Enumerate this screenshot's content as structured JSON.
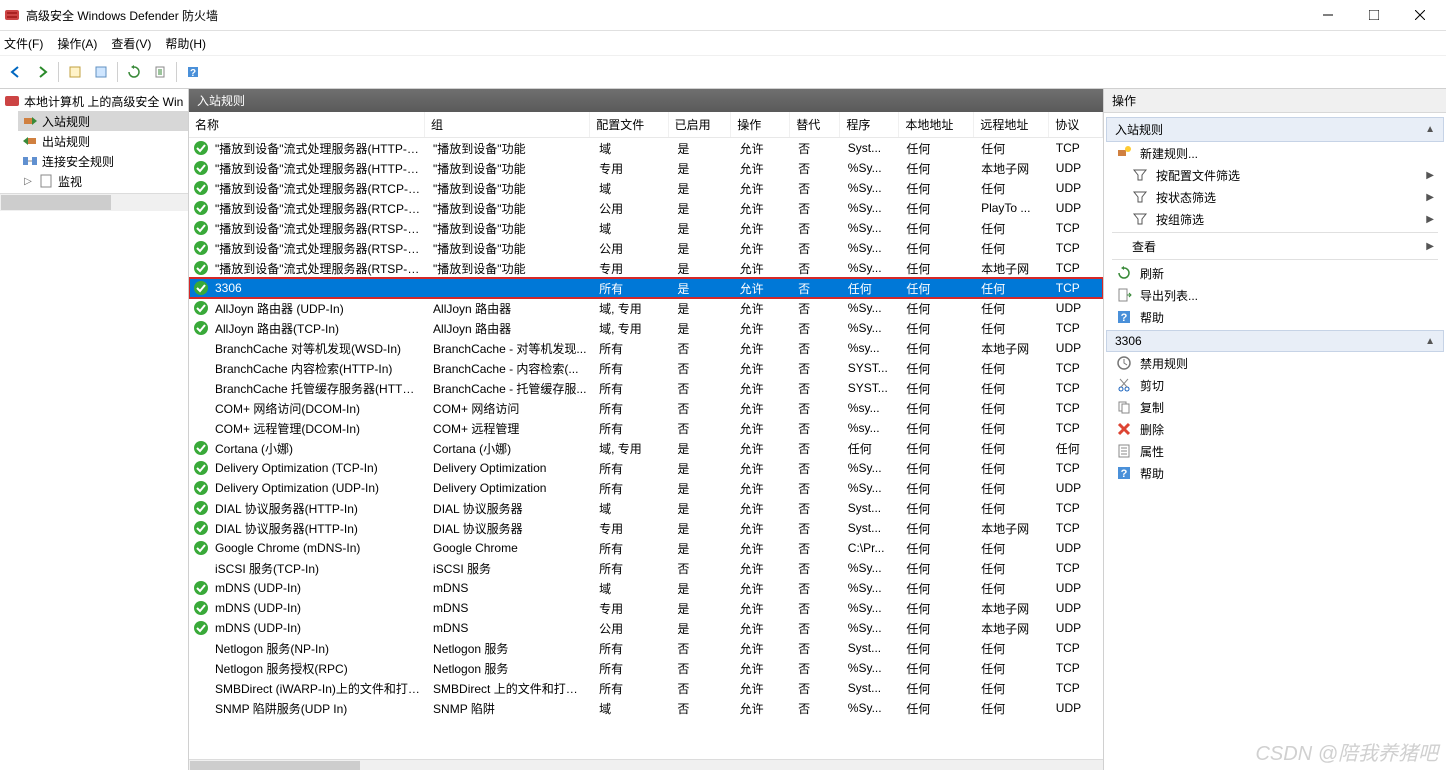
{
  "title": "高级安全 Windows Defender 防火墙",
  "menu": {
    "file": "文件(F)",
    "action": "操作(A)",
    "view": "查看(V)",
    "help": "帮助(H)"
  },
  "tree": {
    "root": "本地计算机 上的高级安全 Win",
    "inbound": "入站规则",
    "outbound": "出站规则",
    "connsec": "连接安全规则",
    "monitor": "监视"
  },
  "mid_header": "入站规则",
  "columns": {
    "name": "名称",
    "group": "组",
    "profile": "配置文件",
    "enabled": "已启用",
    "action": "操作",
    "override": "替代",
    "program": "程序",
    "localaddr": "本地地址",
    "remoteaddr": "远程地址",
    "protocol": "协议"
  },
  "rows": [
    {
      "en": true,
      "name": "\"播放到设备\"流式处理服务器(HTTP-Stre...",
      "group": "\"播放到设备\"功能",
      "profile": "域",
      "enabled": "是",
      "action": "允许",
      "override": "否",
      "program": "Syst...",
      "local": "任何",
      "remote": "任何",
      "proto": "TCP"
    },
    {
      "en": true,
      "name": "\"播放到设备\"流式处理服务器(HTTP-Stre...",
      "group": "\"播放到设备\"功能",
      "profile": "专用",
      "enabled": "是",
      "action": "允许",
      "override": "否",
      "program": "%Sy...",
      "local": "任何",
      "remote": "本地子网",
      "proto": "UDP"
    },
    {
      "en": true,
      "name": "\"播放到设备\"流式处理服务器(RTCP-Stre...",
      "group": "\"播放到设备\"功能",
      "profile": "域",
      "enabled": "是",
      "action": "允许",
      "override": "否",
      "program": "%Sy...",
      "local": "任何",
      "remote": "任何",
      "proto": "UDP"
    },
    {
      "en": true,
      "name": "\"播放到设备\"流式处理服务器(RTCP-Stre...",
      "group": "\"播放到设备\"功能",
      "profile": "公用",
      "enabled": "是",
      "action": "允许",
      "override": "否",
      "program": "%Sy...",
      "local": "任何",
      "remote": "PlayTo ...",
      "proto": "UDP"
    },
    {
      "en": true,
      "name": "\"播放到设备\"流式处理服务器(RTSP-Stre...",
      "group": "\"播放到设备\"功能",
      "profile": "域",
      "enabled": "是",
      "action": "允许",
      "override": "否",
      "program": "%Sy...",
      "local": "任何",
      "remote": "任何",
      "proto": "TCP"
    },
    {
      "en": true,
      "name": "\"播放到设备\"流式处理服务器(RTSP-Stre...",
      "group": "\"播放到设备\"功能",
      "profile": "公用",
      "enabled": "是",
      "action": "允许",
      "override": "否",
      "program": "%Sy...",
      "local": "任何",
      "remote": "任何",
      "proto": "TCP"
    },
    {
      "en": true,
      "name": "\"播放到设备\"流式处理服务器(RTSP-Stre...",
      "group": "\"播放到设备\"功能",
      "profile": "专用",
      "enabled": "是",
      "action": "允许",
      "override": "否",
      "program": "%Sy...",
      "local": "任何",
      "remote": "本地子网",
      "proto": "TCP"
    },
    {
      "sel": true,
      "en": true,
      "name": "3306",
      "group": "",
      "profile": "所有",
      "enabled": "是",
      "action": "允许",
      "override": "否",
      "program": "任何",
      "local": "任何",
      "remote": "任何",
      "proto": "TCP"
    },
    {
      "en": true,
      "name": "AllJoyn 路由器 (UDP-In)",
      "group": "AllJoyn 路由器",
      "profile": "域, 专用",
      "enabled": "是",
      "action": "允许",
      "override": "否",
      "program": "%Sy...",
      "local": "任何",
      "remote": "任何",
      "proto": "UDP"
    },
    {
      "en": true,
      "name": "AllJoyn 路由器(TCP-In)",
      "group": "AllJoyn 路由器",
      "profile": "域, 专用",
      "enabled": "是",
      "action": "允许",
      "override": "否",
      "program": "%Sy...",
      "local": "任何",
      "remote": "任何",
      "proto": "TCP"
    },
    {
      "en": false,
      "name": "BranchCache 对等机发现(WSD-In)",
      "group": "BranchCache - 对等机发现...",
      "profile": "所有",
      "enabled": "否",
      "action": "允许",
      "override": "否",
      "program": "%sy...",
      "local": "任何",
      "remote": "本地子网",
      "proto": "UDP"
    },
    {
      "en": false,
      "name": "BranchCache 内容检索(HTTP-In)",
      "group": "BranchCache - 内容检索(...",
      "profile": "所有",
      "enabled": "否",
      "action": "允许",
      "override": "否",
      "program": "SYST...",
      "local": "任何",
      "remote": "任何",
      "proto": "TCP"
    },
    {
      "en": false,
      "name": "BranchCache 托管缓存服务器(HTTP-In)",
      "group": "BranchCache - 托管缓存服...",
      "profile": "所有",
      "enabled": "否",
      "action": "允许",
      "override": "否",
      "program": "SYST...",
      "local": "任何",
      "remote": "任何",
      "proto": "TCP"
    },
    {
      "en": false,
      "name": "COM+ 网络访问(DCOM-In)",
      "group": "COM+ 网络访问",
      "profile": "所有",
      "enabled": "否",
      "action": "允许",
      "override": "否",
      "program": "%sy...",
      "local": "任何",
      "remote": "任何",
      "proto": "TCP"
    },
    {
      "en": false,
      "name": "COM+ 远程管理(DCOM-In)",
      "group": "COM+ 远程管理",
      "profile": "所有",
      "enabled": "否",
      "action": "允许",
      "override": "否",
      "program": "%sy...",
      "local": "任何",
      "remote": "任何",
      "proto": "TCP"
    },
    {
      "en": true,
      "name": "Cortana (小娜)",
      "group": "Cortana (小娜)",
      "profile": "域, 专用",
      "enabled": "是",
      "action": "允许",
      "override": "否",
      "program": "任何",
      "local": "任何",
      "remote": "任何",
      "proto": "任何"
    },
    {
      "en": true,
      "name": "Delivery Optimization (TCP-In)",
      "group": "Delivery Optimization",
      "profile": "所有",
      "enabled": "是",
      "action": "允许",
      "override": "否",
      "program": "%Sy...",
      "local": "任何",
      "remote": "任何",
      "proto": "TCP"
    },
    {
      "en": true,
      "name": "Delivery Optimization (UDP-In)",
      "group": "Delivery Optimization",
      "profile": "所有",
      "enabled": "是",
      "action": "允许",
      "override": "否",
      "program": "%Sy...",
      "local": "任何",
      "remote": "任何",
      "proto": "UDP"
    },
    {
      "en": true,
      "name": "DIAL 协议服务器(HTTP-In)",
      "group": "DIAL 协议服务器",
      "profile": "域",
      "enabled": "是",
      "action": "允许",
      "override": "否",
      "program": "Syst...",
      "local": "任何",
      "remote": "任何",
      "proto": "TCP"
    },
    {
      "en": true,
      "name": "DIAL 协议服务器(HTTP-In)",
      "group": "DIAL 协议服务器",
      "profile": "专用",
      "enabled": "是",
      "action": "允许",
      "override": "否",
      "program": "Syst...",
      "local": "任何",
      "remote": "本地子网",
      "proto": "TCP"
    },
    {
      "en": true,
      "name": "Google Chrome (mDNS-In)",
      "group": "Google Chrome",
      "profile": "所有",
      "enabled": "是",
      "action": "允许",
      "override": "否",
      "program": "C:\\Pr...",
      "local": "任何",
      "remote": "任何",
      "proto": "UDP"
    },
    {
      "en": false,
      "name": "iSCSI 服务(TCP-In)",
      "group": "iSCSI 服务",
      "profile": "所有",
      "enabled": "否",
      "action": "允许",
      "override": "否",
      "program": "%Sy...",
      "local": "任何",
      "remote": "任何",
      "proto": "TCP"
    },
    {
      "en": true,
      "name": "mDNS (UDP-In)",
      "group": "mDNS",
      "profile": "域",
      "enabled": "是",
      "action": "允许",
      "override": "否",
      "program": "%Sy...",
      "local": "任何",
      "remote": "任何",
      "proto": "UDP"
    },
    {
      "en": true,
      "name": "mDNS (UDP-In)",
      "group": "mDNS",
      "profile": "专用",
      "enabled": "是",
      "action": "允许",
      "override": "否",
      "program": "%Sy...",
      "local": "任何",
      "remote": "本地子网",
      "proto": "UDP"
    },
    {
      "en": true,
      "name": "mDNS (UDP-In)",
      "group": "mDNS",
      "profile": "公用",
      "enabled": "是",
      "action": "允许",
      "override": "否",
      "program": "%Sy...",
      "local": "任何",
      "remote": "本地子网",
      "proto": "UDP"
    },
    {
      "en": false,
      "name": "Netlogon 服务(NP-In)",
      "group": "Netlogon 服务",
      "profile": "所有",
      "enabled": "否",
      "action": "允许",
      "override": "否",
      "program": "Syst...",
      "local": "任何",
      "remote": "任何",
      "proto": "TCP"
    },
    {
      "en": false,
      "name": "Netlogon 服务授权(RPC)",
      "group": "Netlogon 服务",
      "profile": "所有",
      "enabled": "否",
      "action": "允许",
      "override": "否",
      "program": "%Sy...",
      "local": "任何",
      "remote": "任何",
      "proto": "TCP"
    },
    {
      "en": false,
      "name": "SMBDirect (iWARP-In)上的文件和打印...",
      "group": "SMBDirect 上的文件和打印...",
      "profile": "所有",
      "enabled": "否",
      "action": "允许",
      "override": "否",
      "program": "Syst...",
      "local": "任何",
      "remote": "任何",
      "proto": "TCP"
    },
    {
      "en": false,
      "name": "SNMP 陷阱服务(UDP In)",
      "group": "SNMP 陷阱",
      "profile": "域",
      "enabled": "否",
      "action": "允许",
      "override": "否",
      "program": "%Sy...",
      "local": "任何",
      "remote": "任何",
      "proto": "UDP"
    }
  ],
  "actions_header": "操作",
  "actions": {
    "group1_title": "入站规则",
    "new_rule": "新建规则...",
    "filter_profile": "按配置文件筛选",
    "filter_state": "按状态筛选",
    "filter_group": "按组筛选",
    "view": "查看",
    "refresh": "刷新",
    "export": "导出列表...",
    "help": "帮助",
    "group2_title": "3306",
    "disable": "禁用规则",
    "cut": "剪切",
    "copy": "复制",
    "delete": "删除",
    "properties": "属性",
    "help2": "帮助"
  },
  "watermark": "CSDN @陪我养猪吧"
}
